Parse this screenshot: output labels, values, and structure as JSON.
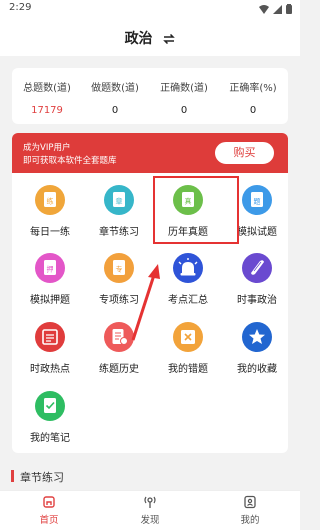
{
  "status": {
    "time": "2:29"
  },
  "header": {
    "title": "政治",
    "switch_icon": "switch-arrows-icon"
  },
  "stats": [
    {
      "label": "总题数(道)",
      "value": "17179",
      "color": "#e04040"
    },
    {
      "label": "做题数(道)",
      "value": "0",
      "color": "#222222"
    },
    {
      "label": "正确数(道)",
      "value": "0",
      "color": "#222222"
    },
    {
      "label": "正确率(%)",
      "value": "0",
      "color": "#222222"
    }
  ],
  "vip": {
    "line1": "成为VIP用户",
    "line2": "即可获取本软件全套题库",
    "buy_label": "购买",
    "accent": "#de3c3a"
  },
  "grid": [
    {
      "label": "每日一练",
      "icon": "daily-practice-icon",
      "color": "#f0a63a",
      "glyph": "练"
    },
    {
      "label": "章节练习",
      "icon": "chapter-practice-icon",
      "color": "#36b6c9",
      "glyph": "章"
    },
    {
      "label": "历年真题",
      "icon": "past-exams-icon",
      "color": "#6cbf4a",
      "glyph": "真"
    },
    {
      "label": "模拟试题",
      "icon": "mock-questions-icon",
      "color": "#3d9ae8",
      "glyph": "题"
    },
    {
      "label": "模拟押题",
      "icon": "mock-prediction-icon",
      "color": "#e356c8",
      "glyph": "押"
    },
    {
      "label": "专项练习",
      "icon": "special-practice-icon",
      "color": "#f2a03c",
      "glyph": "专"
    },
    {
      "label": "考点汇总",
      "icon": "alarm-icon",
      "color": "#2f54d8",
      "glyph": ""
    },
    {
      "label": "时事政治",
      "icon": "scroll-icon",
      "color": "#6a4ad0",
      "glyph": ""
    },
    {
      "label": "时政热点",
      "icon": "hot-news-icon",
      "color": "#e03c3c",
      "glyph": ""
    },
    {
      "label": "练题历史",
      "icon": "history-icon",
      "color": "#ee5a5a",
      "glyph": ""
    },
    {
      "label": "我的错题",
      "icon": "wrong-answers-icon",
      "color": "#f2a33a",
      "glyph": ""
    },
    {
      "label": "我的收藏",
      "icon": "star-icon",
      "color": "#2266d0",
      "glyph": ""
    },
    {
      "label": "我的笔记",
      "icon": "notes-icon",
      "color": "#2ebd62",
      "glyph": ""
    }
  ],
  "section": {
    "title": "章节练习"
  },
  "tabs": [
    {
      "label": "首页",
      "icon": "home-icon",
      "active": true
    },
    {
      "label": "发现",
      "icon": "discover-icon",
      "active": false
    },
    {
      "label": "我的",
      "icon": "profile-icon",
      "active": false
    }
  ],
  "colors": {
    "active_tab": "#e04040",
    "inactive_tab": "#555555",
    "annotation": "#e53232"
  }
}
